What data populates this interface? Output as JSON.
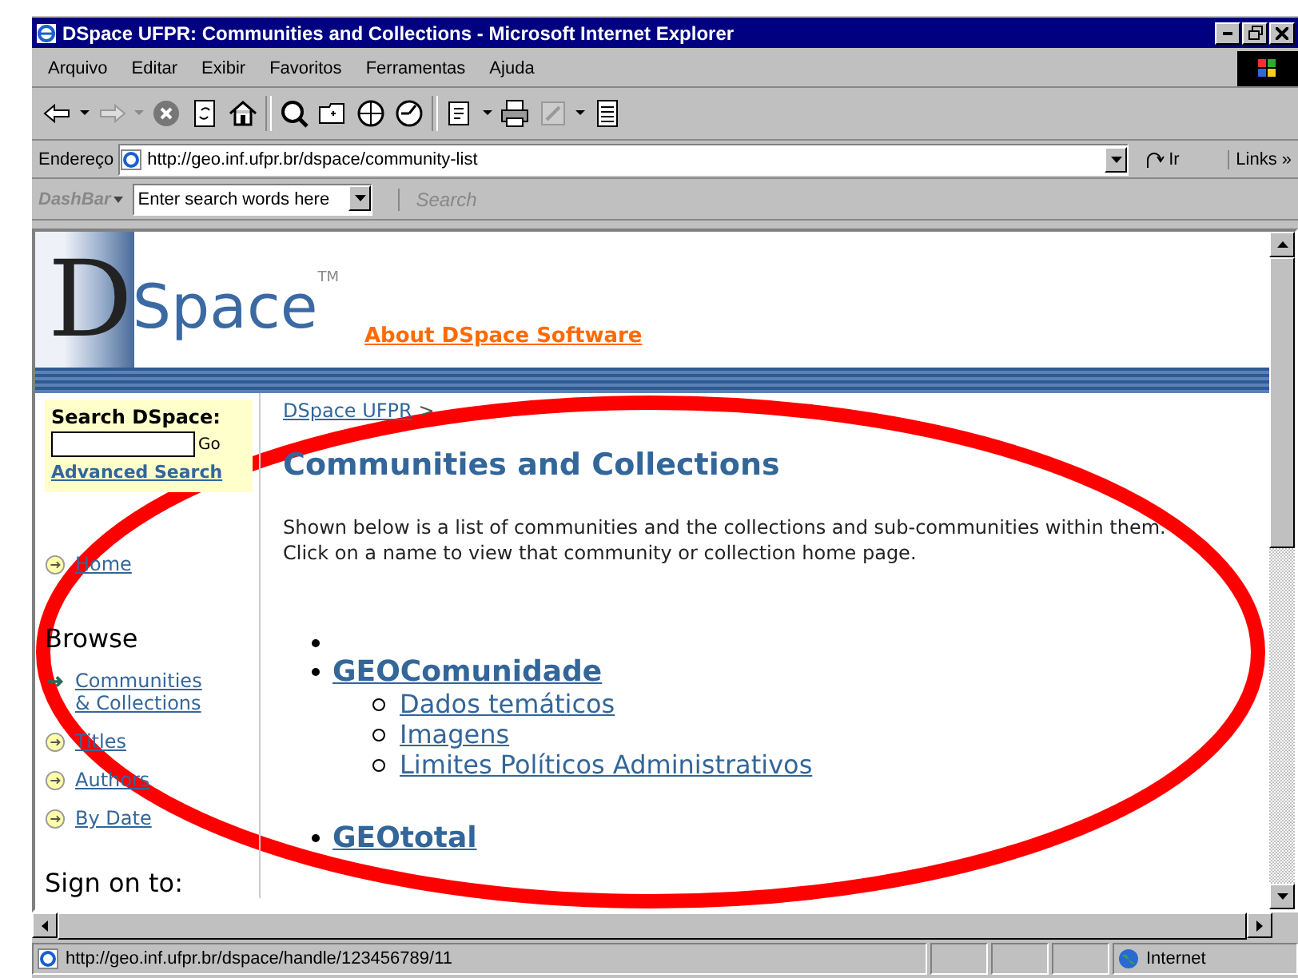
{
  "window": {
    "title": "DSpace UFPR: Communities and Collections - Microsoft Internet Explorer"
  },
  "menu": [
    {
      "label": "Arquivo"
    },
    {
      "label": "Editar"
    },
    {
      "label": "Exibir"
    },
    {
      "label": "Favoritos"
    },
    {
      "label": "Ferramentas"
    },
    {
      "label": "Ajuda"
    }
  ],
  "address_bar": {
    "label": "Endereço",
    "value": "http://geo.inf.ufpr.br/dspace/community-list",
    "go": "Ir",
    "links": "Links »"
  },
  "dashbar": {
    "label": "DashBar",
    "placeholder": "Enter search words here",
    "search": "Search"
  },
  "header": {
    "logo_letter": "D",
    "logo_word": "Space",
    "trademark": "TM",
    "about_link": "About DSpace Software"
  },
  "sidebar": {
    "search_title": "Search DSpace:",
    "go": "Go",
    "advanced": "Advanced Search",
    "home": "Home",
    "browse_title": "Browse",
    "browse_items": [
      {
        "label": "Communities & Collections",
        "selected": true
      },
      {
        "label": "Titles",
        "selected": false
      },
      {
        "label": "Authors",
        "selected": false
      },
      {
        "label": "By Date",
        "selected": false
      }
    ],
    "sign_on": "Sign on to:"
  },
  "main": {
    "breadcrumb": "DSpace UFPR",
    "breadcrumb_sep": ">",
    "title": "Communities and Collections",
    "intro": "Shown below is a list of communities and the collections and sub-communities within them. Click on a name to view that community or collection home page.",
    "communities": [
      {
        "kind": "blank"
      },
      {
        "kind": "link",
        "name": "GEOComunidade",
        "children": [
          {
            "name": "Dados temáticos"
          },
          {
            "name": "Imagens"
          },
          {
            "name": "Limites Políticos Administrativos"
          }
        ]
      },
      {
        "kind": "link",
        "name": "GEOtotal"
      }
    ]
  },
  "status_bar": {
    "url": "http://geo.inf.ufpr.br/dspace/handle/123456789/11",
    "zone": "Internet"
  }
}
